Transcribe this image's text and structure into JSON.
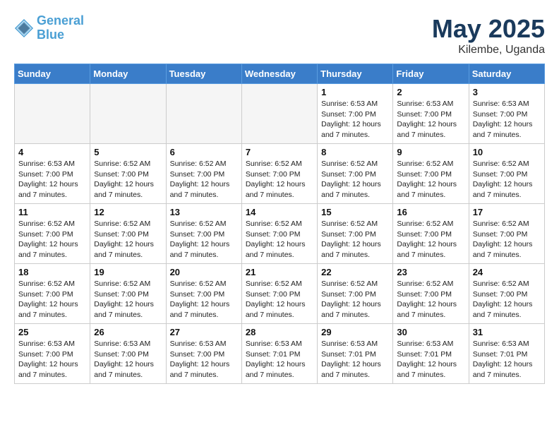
{
  "header": {
    "logo_line1": "General",
    "logo_line2": "Blue",
    "month": "May 2025",
    "location": "Kilembe, Uganda"
  },
  "days_of_week": [
    "Sunday",
    "Monday",
    "Tuesday",
    "Wednesday",
    "Thursday",
    "Friday",
    "Saturday"
  ],
  "weeks": [
    [
      {
        "day": "",
        "info": ""
      },
      {
        "day": "",
        "info": ""
      },
      {
        "day": "",
        "info": ""
      },
      {
        "day": "",
        "info": ""
      },
      {
        "day": "1",
        "info": "Sunrise: 6:53 AM\nSunset: 7:00 PM\nDaylight: 12 hours\nand 7 minutes."
      },
      {
        "day": "2",
        "info": "Sunrise: 6:53 AM\nSunset: 7:00 PM\nDaylight: 12 hours\nand 7 minutes."
      },
      {
        "day": "3",
        "info": "Sunrise: 6:53 AM\nSunset: 7:00 PM\nDaylight: 12 hours\nand 7 minutes."
      }
    ],
    [
      {
        "day": "4",
        "info": "Sunrise: 6:53 AM\nSunset: 7:00 PM\nDaylight: 12 hours\nand 7 minutes."
      },
      {
        "day": "5",
        "info": "Sunrise: 6:52 AM\nSunset: 7:00 PM\nDaylight: 12 hours\nand 7 minutes."
      },
      {
        "day": "6",
        "info": "Sunrise: 6:52 AM\nSunset: 7:00 PM\nDaylight: 12 hours\nand 7 minutes."
      },
      {
        "day": "7",
        "info": "Sunrise: 6:52 AM\nSunset: 7:00 PM\nDaylight: 12 hours\nand 7 minutes."
      },
      {
        "day": "8",
        "info": "Sunrise: 6:52 AM\nSunset: 7:00 PM\nDaylight: 12 hours\nand 7 minutes."
      },
      {
        "day": "9",
        "info": "Sunrise: 6:52 AM\nSunset: 7:00 PM\nDaylight: 12 hours\nand 7 minutes."
      },
      {
        "day": "10",
        "info": "Sunrise: 6:52 AM\nSunset: 7:00 PM\nDaylight: 12 hours\nand 7 minutes."
      }
    ],
    [
      {
        "day": "11",
        "info": "Sunrise: 6:52 AM\nSunset: 7:00 PM\nDaylight: 12 hours\nand 7 minutes."
      },
      {
        "day": "12",
        "info": "Sunrise: 6:52 AM\nSunset: 7:00 PM\nDaylight: 12 hours\nand 7 minutes."
      },
      {
        "day": "13",
        "info": "Sunrise: 6:52 AM\nSunset: 7:00 PM\nDaylight: 12 hours\nand 7 minutes."
      },
      {
        "day": "14",
        "info": "Sunrise: 6:52 AM\nSunset: 7:00 PM\nDaylight: 12 hours\nand 7 minutes."
      },
      {
        "day": "15",
        "info": "Sunrise: 6:52 AM\nSunset: 7:00 PM\nDaylight: 12 hours\nand 7 minutes."
      },
      {
        "day": "16",
        "info": "Sunrise: 6:52 AM\nSunset: 7:00 PM\nDaylight: 12 hours\nand 7 minutes."
      },
      {
        "day": "17",
        "info": "Sunrise: 6:52 AM\nSunset: 7:00 PM\nDaylight: 12 hours\nand 7 minutes."
      }
    ],
    [
      {
        "day": "18",
        "info": "Sunrise: 6:52 AM\nSunset: 7:00 PM\nDaylight: 12 hours\nand 7 minutes."
      },
      {
        "day": "19",
        "info": "Sunrise: 6:52 AM\nSunset: 7:00 PM\nDaylight: 12 hours\nand 7 minutes."
      },
      {
        "day": "20",
        "info": "Sunrise: 6:52 AM\nSunset: 7:00 PM\nDaylight: 12 hours\nand 7 minutes."
      },
      {
        "day": "21",
        "info": "Sunrise: 6:52 AM\nSunset: 7:00 PM\nDaylight: 12 hours\nand 7 minutes."
      },
      {
        "day": "22",
        "info": "Sunrise: 6:52 AM\nSunset: 7:00 PM\nDaylight: 12 hours\nand 7 minutes."
      },
      {
        "day": "23",
        "info": "Sunrise: 6:52 AM\nSunset: 7:00 PM\nDaylight: 12 hours\nand 7 minutes."
      },
      {
        "day": "24",
        "info": "Sunrise: 6:52 AM\nSunset: 7:00 PM\nDaylight: 12 hours\nand 7 minutes."
      }
    ],
    [
      {
        "day": "25",
        "info": "Sunrise: 6:53 AM\nSunset: 7:00 PM\nDaylight: 12 hours\nand 7 minutes."
      },
      {
        "day": "26",
        "info": "Sunrise: 6:53 AM\nSunset: 7:00 PM\nDaylight: 12 hours\nand 7 minutes."
      },
      {
        "day": "27",
        "info": "Sunrise: 6:53 AM\nSunset: 7:00 PM\nDaylight: 12 hours\nand 7 minutes."
      },
      {
        "day": "28",
        "info": "Sunrise: 6:53 AM\nSunset: 7:01 PM\nDaylight: 12 hours\nand 7 minutes."
      },
      {
        "day": "29",
        "info": "Sunrise: 6:53 AM\nSunset: 7:01 PM\nDaylight: 12 hours\nand 7 minutes."
      },
      {
        "day": "30",
        "info": "Sunrise: 6:53 AM\nSunset: 7:01 PM\nDaylight: 12 hours\nand 7 minutes."
      },
      {
        "day": "31",
        "info": "Sunrise: 6:53 AM\nSunset: 7:01 PM\nDaylight: 12 hours\nand 7 minutes."
      }
    ]
  ]
}
